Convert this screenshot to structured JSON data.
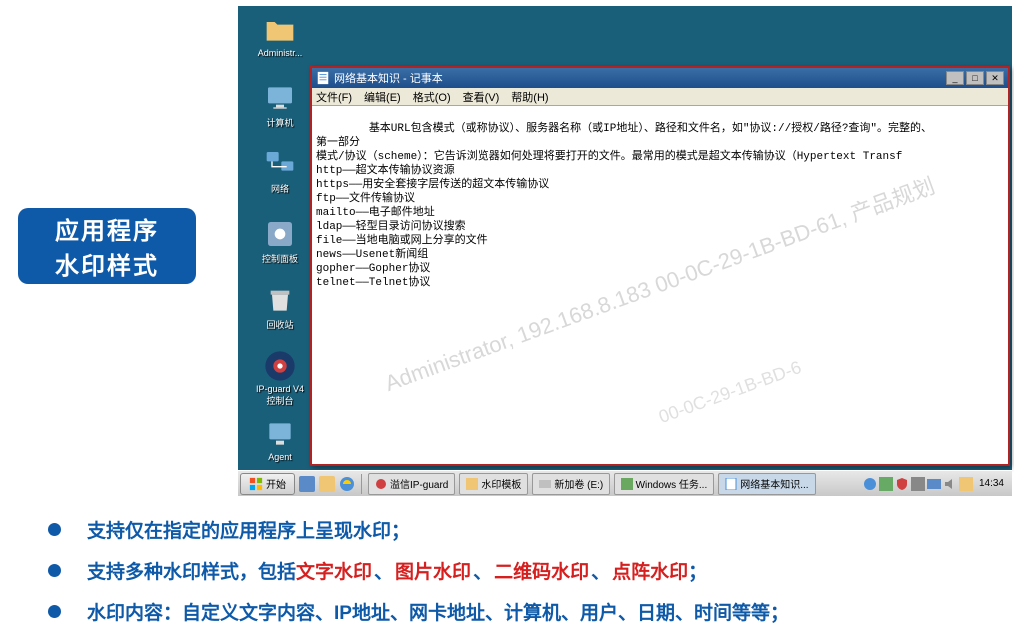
{
  "badge": {
    "line1": "应用程序",
    "line2": "水印样式"
  },
  "desktop_icons": {
    "admin": "Administr...",
    "computer": "计算机",
    "network": "网络",
    "control": "控制面板",
    "recycle": "回收站",
    "ipguard": "IP-guard V4\n控制台",
    "agent": "Agent"
  },
  "notepad": {
    "title": "网络基本知识 - 记事本",
    "menu": {
      "file": "文件(F)",
      "edit": "编辑(E)",
      "format": "格式(O)",
      "view": "查看(V)",
      "help": "帮助(H)"
    },
    "content": "基本URL包含模式（或称协议）、服务器名称（或IP地址）、路径和文件名，如\"协议://授权/路径?查询\"。完整的、\n第一部分\n模式/协议（scheme）：它告诉浏览器如何处理将要打开的文件。最常用的模式是超文本传输协议（Hypertext Transf\nhttp——超文本传输协议资源\nhttps——用安全套接字层传送的超文本传输协议\nftp——文件传输协议\nmailto——电子邮件地址\nldap——轻型目录访问协议搜索\nfile——当地电脑或网上分享的文件\nnews——Usenet新闻组\ngopher——Gopher协议\ntelnet——Telnet协议",
    "watermark1": "Administrator, 192.168.8.183  00-0C-29-1B-BD-61, 产品规划",
    "watermark2": "00-0C-29-1B-BD-6"
  },
  "taskbar": {
    "start": "开始",
    "items": [
      "溢信IP-guard",
      "水印模板",
      "新加卷 (E:)",
      "Windows 任务...",
      "网络基本知识..."
    ],
    "time": "14:34"
  },
  "bullets": {
    "b1": "支持仅在指定的应用程序上呈现水印；",
    "b2_prefix": "支持多种水印样式，包括",
    "b2_wm1": "文字水印",
    "b2_wm2": "图片水印",
    "b2_wm3": "二维码水印",
    "b2_wm4": "点阵水印",
    "b2_suffix": "；",
    "b3": "水印内容：自定义文字内容、IP地址、网卡地址、计算机、用户、日期、时间等等；",
    "sep": "、"
  }
}
